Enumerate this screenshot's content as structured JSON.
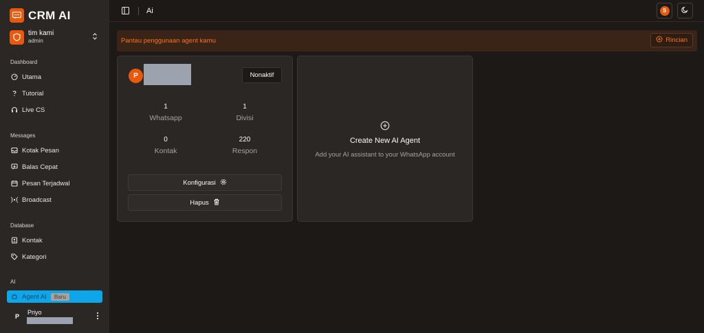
{
  "app": {
    "name": "CRM AI"
  },
  "team": {
    "name": "tim kami",
    "role": "admin"
  },
  "sidebar": {
    "sections": [
      {
        "label": "Dashboard",
        "items": [
          {
            "label": "Utama",
            "icon": "gauge-icon"
          },
          {
            "label": "Tutorial",
            "icon": "question-icon"
          },
          {
            "label": "Live CS",
            "icon": "headset-icon"
          }
        ]
      },
      {
        "label": "Messages",
        "items": [
          {
            "label": "Kotak Pesan",
            "icon": "inbox-icon"
          },
          {
            "label": "Balas Cepat",
            "icon": "quick-reply-icon"
          },
          {
            "label": "Pesan Terjadwal",
            "icon": "calendar-icon"
          },
          {
            "label": "Broadcast",
            "icon": "broadcast-icon"
          }
        ]
      },
      {
        "label": "Database",
        "items": [
          {
            "label": "Kontak",
            "icon": "contact-icon"
          },
          {
            "label": "Kategori",
            "icon": "tag-icon"
          }
        ]
      },
      {
        "label": "AI",
        "items": [
          {
            "label": "Agent AI",
            "icon": "bot-icon",
            "badge": "Baru",
            "active": true
          }
        ]
      }
    ],
    "user": {
      "initial": "P",
      "name": "Priyo"
    }
  },
  "topbar": {
    "breadcrumb": "Ai",
    "avatar_initial": "S"
  },
  "alert": {
    "text": "Pantau penggunaan agent kamu",
    "button_label": "Rincian"
  },
  "agent_card": {
    "avatar_initial": "P",
    "status_label": "Nonaktif",
    "stats": [
      {
        "value": "1",
        "label": "Whatsapp"
      },
      {
        "value": "1",
        "label": "Divisi"
      },
      {
        "value": "0",
        "label": "Kontak"
      },
      {
        "value": "220",
        "label": "Respon"
      }
    ],
    "configure_label": "Konfigurasi",
    "delete_label": "Hapus"
  },
  "create_card": {
    "title": "Create New AI Agent",
    "subtitle": "Add your AI assistant to your WhatsApp account"
  },
  "colors": {
    "accent": "#ea580c",
    "active_nav": "#0ea5e9",
    "alert_bg": "#3a2417"
  }
}
